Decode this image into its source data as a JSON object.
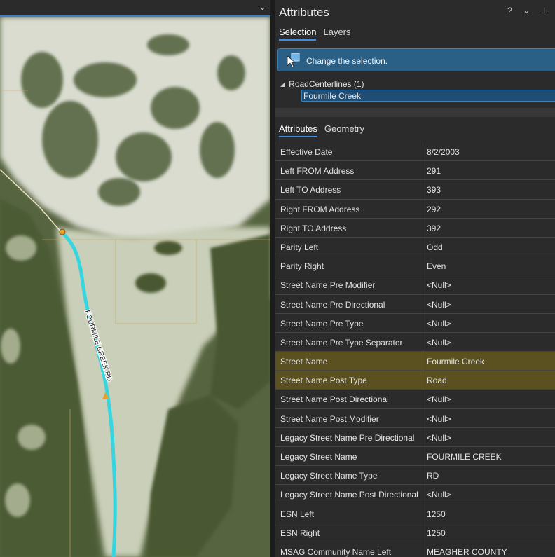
{
  "pane": {
    "title": "Attributes",
    "controls": "? ⌄ ⊥",
    "top_tabs": [
      {
        "label": "Selection",
        "active": true
      },
      {
        "label": "Layers",
        "active": false
      }
    ],
    "banner_text": "Change the selection.",
    "tree": {
      "layer": "RoadCenterlines (1)",
      "feature": "Fourmile Creek"
    },
    "bottom_tabs": [
      {
        "label": "Attributes",
        "active": true
      },
      {
        "label": "Geometry",
        "active": false
      }
    ]
  },
  "map": {
    "road_label": "FOURMILE CREEK RD"
  },
  "attributes": [
    {
      "field": "Effective Date",
      "value": "8/2/2003"
    },
    {
      "field": "Left FROM Address",
      "value": "291"
    },
    {
      "field": "Left TO Address",
      "value": "393"
    },
    {
      "field": "Right FROM Address",
      "value": "292"
    },
    {
      "field": "Right TO Address",
      "value": "392"
    },
    {
      "field": "Parity Left",
      "value": "Odd"
    },
    {
      "field": "Parity Right",
      "value": "Even"
    },
    {
      "field": "Street Name Pre Modifier",
      "value": "<Null>"
    },
    {
      "field": "Street Name Pre Directional",
      "value": "<Null>"
    },
    {
      "field": "Street Name Pre Type",
      "value": "<Null>"
    },
    {
      "field": "Street Name Pre Type Separator",
      "value": "<Null>"
    },
    {
      "field": "Street Name",
      "value": "Fourmile Creek",
      "highlight": true
    },
    {
      "field": "Street Name Post Type",
      "value": "Road",
      "highlight": true
    },
    {
      "field": "Street Name Post Directional",
      "value": "<Null>"
    },
    {
      "field": "Street Name Post Modifier",
      "value": "<Null>"
    },
    {
      "field": "Legacy Street Name Pre Directional",
      "value": "<Null>"
    },
    {
      "field": "Legacy Street Name",
      "value": "FOURMILE CREEK"
    },
    {
      "field": "Legacy Street Name Type",
      "value": "RD"
    },
    {
      "field": "Legacy Street Name Post Directional",
      "value": "<Null>"
    },
    {
      "field": "ESN Left",
      "value": "1250"
    },
    {
      "field": "ESN Right",
      "value": "1250"
    },
    {
      "field": "MSAG Community Name Left",
      "value": "MEAGHER COUNTY"
    }
  ],
  "colors": {
    "highlight_row": "#5a5020",
    "selected_road": "#35d6e0",
    "accent": "#3d8ee0"
  }
}
